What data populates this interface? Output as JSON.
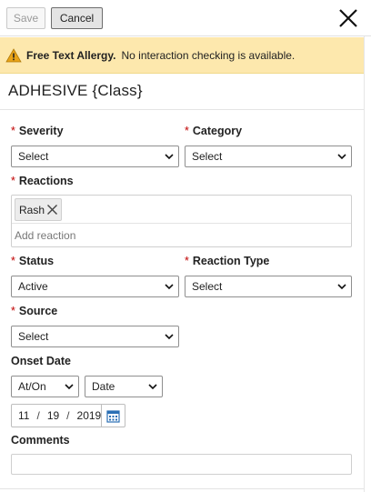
{
  "toolbar": {
    "save_label": "Save",
    "cancel_label": "Cancel",
    "close_icon": "close-icon"
  },
  "banner": {
    "title": "Free Text Allergy.",
    "message": "No interaction checking is available.",
    "icon": "warning-icon",
    "color": "#fde8ad"
  },
  "allergy": {
    "name": "ADHESIVE {Class}"
  },
  "required_marker": "*",
  "fields": {
    "severity": {
      "label": "Severity",
      "value": "Select"
    },
    "category": {
      "label": "Category",
      "value": "Select"
    },
    "reactions": {
      "label": "Reactions",
      "chips": [
        {
          "label": "Rash"
        }
      ],
      "placeholder": "Add reaction"
    },
    "status": {
      "label": "Status",
      "value": "Active"
    },
    "reaction_type": {
      "label": "Reaction Type",
      "value": "Select"
    },
    "source": {
      "label": "Source",
      "value": "Select"
    },
    "onset_date": {
      "label": "Onset Date",
      "qualifier": "At/On",
      "precision": "Date",
      "month": "11",
      "day": "19",
      "year": "2019",
      "separator": "/"
    },
    "comments": {
      "label": "Comments",
      "value": ""
    }
  }
}
